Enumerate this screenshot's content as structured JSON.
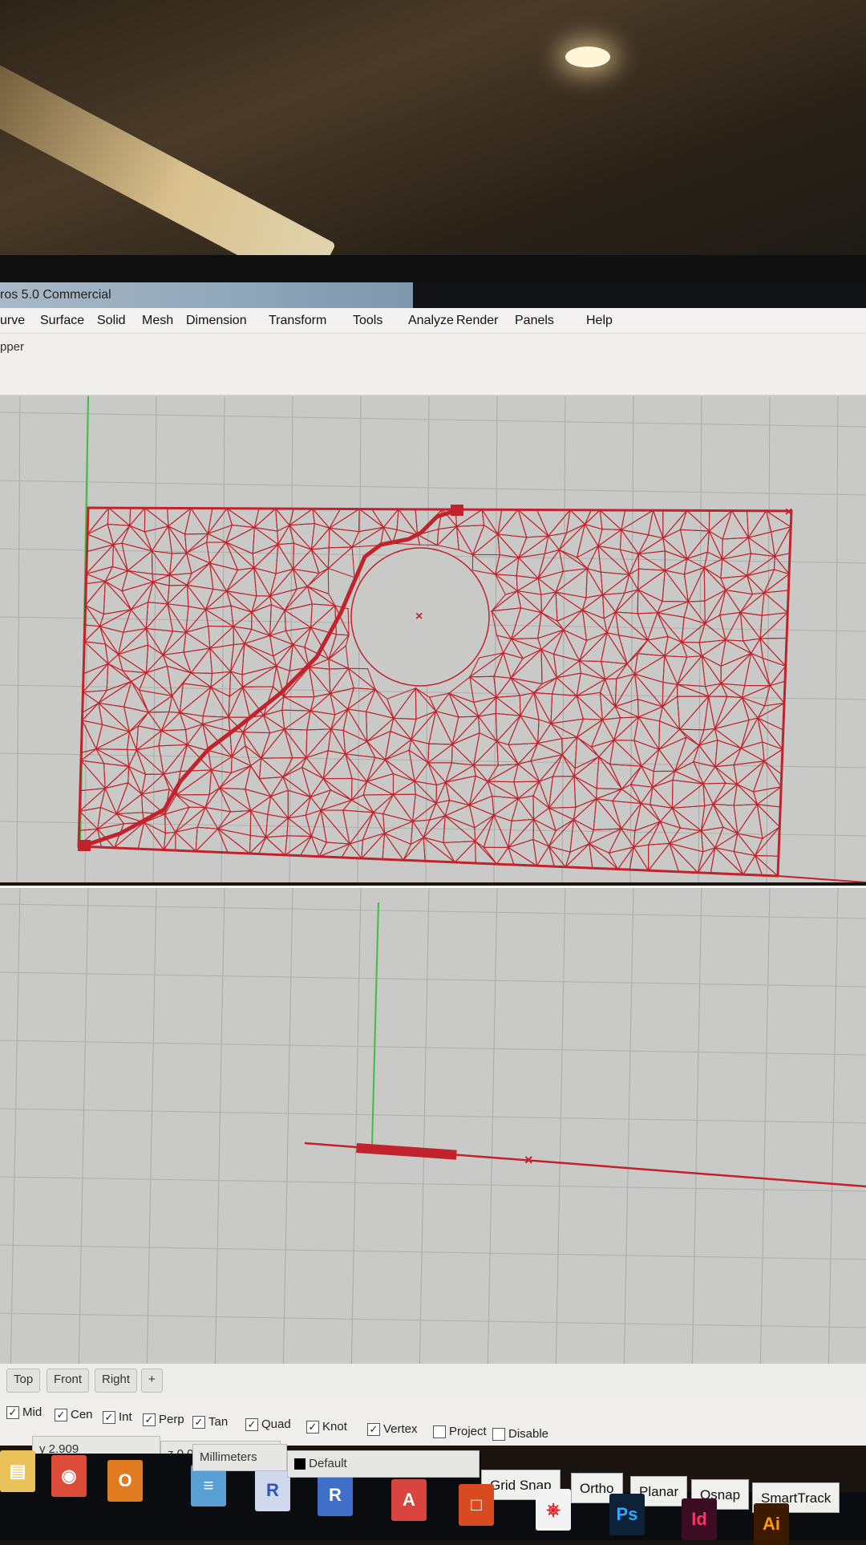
{
  "window": {
    "title": "ros 5.0 Commercial"
  },
  "menu": [
    "urve",
    "Surface",
    "Solid",
    "Mesh",
    "Dimension",
    "Transform",
    "Tools",
    "Analyze",
    "Render",
    "Panels",
    "Help"
  ],
  "command": {
    "text": "pper"
  },
  "viewport_tabs": [
    "Top",
    "Front",
    "Right",
    "+"
  ],
  "osnaps": [
    {
      "label": "Mid",
      "checked": true
    },
    {
      "label": "Cen",
      "checked": true
    },
    {
      "label": "Int",
      "checked": true
    },
    {
      "label": "Perp",
      "checked": true
    },
    {
      "label": "Tan",
      "checked": true
    },
    {
      "label": "Quad",
      "checked": true
    },
    {
      "label": "Knot",
      "checked": true
    },
    {
      "label": "Vertex",
      "checked": true
    },
    {
      "label": "Project",
      "checked": false
    },
    {
      "label": "Disable",
      "checked": false
    }
  ],
  "status": {
    "y": "y 2.909",
    "z": "z 0.000",
    "units": "Millimeters",
    "layer": "Default"
  },
  "toggles": [
    "Grid Snap",
    "Ortho",
    "Planar",
    "Osnap",
    "SmartTrack"
  ],
  "taskbar_icons": [
    "file-explorer",
    "chrome",
    "outlook",
    "notepad",
    "revit",
    "revit-2",
    "autocad",
    "office",
    "acrobat",
    "photoshop",
    "indesign",
    "illustrator"
  ],
  "colors": {
    "geometry": "#c0232b",
    "y_axis": "#3fbf3f",
    "viewport_bg": "#c9c9c7"
  }
}
